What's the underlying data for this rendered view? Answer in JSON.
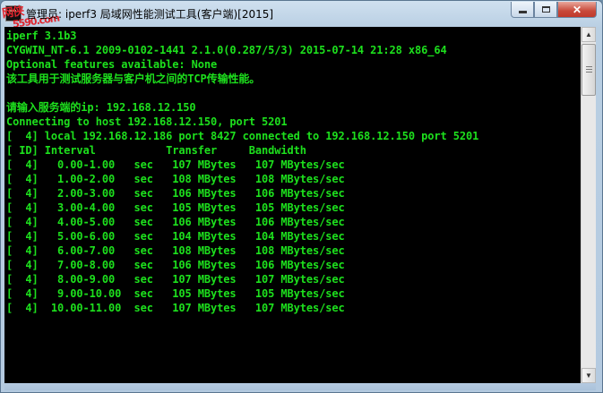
{
  "window": {
    "title": "管理员: iperf3 局域网性能测试工具(客户端)[2015]",
    "watermark_top": "网侠",
    "watermark_bottom": "5590.com",
    "min_icon": "minimize-icon",
    "max_icon": "maximize-icon",
    "close_icon": "close-icon",
    "close_glyph": "✕"
  },
  "console": {
    "text_color": "#1de01d",
    "background": "#000000",
    "lines": [
      "iperf 3.1b3",
      "CYGWIN_NT-6.1 2009-0102-1441 2.1.0(0.287/5/3) 2015-07-14 21:28 x86_64",
      "Optional features available: None",
      "该工具用于测试服务器与客户机之间的TCP传输性能。",
      "",
      "请输入服务端的ip: 192.168.12.150",
      "Connecting to host 192.168.12.150, port 5201",
      "[  4] local 192.168.12.186 port 8427 connected to 192.168.12.150 port 5201",
      "[ ID] Interval           Transfer     Bandwidth",
      "[  4]   0.00-1.00   sec   107 MBytes   107 MBytes/sec",
      "[  4]   1.00-2.00   sec   108 MBytes   108 MBytes/sec",
      "[  4]   2.00-3.00   sec   106 MBytes   106 MBytes/sec",
      "[  4]   3.00-4.00   sec   105 MBytes   105 MBytes/sec",
      "[  4]   4.00-5.00   sec   106 MBytes   106 MBytes/sec",
      "[  4]   5.00-6.00   sec   104 MBytes   104 MBytes/sec",
      "[  4]   6.00-7.00   sec   108 MBytes   108 MBytes/sec",
      "[  4]   7.00-8.00   sec   106 MBytes   106 MBytes/sec",
      "[  4]   8.00-9.00   sec   107 MBytes   107 MBytes/sec",
      "[  4]   9.00-10.00  sec   105 MBytes   105 MBytes/sec",
      "[  4]  10.00-11.00  sec   107 MBytes   107 MBytes/sec"
    ]
  },
  "scrollbar": {
    "up_glyph": "▲",
    "down_glyph": "▼"
  }
}
